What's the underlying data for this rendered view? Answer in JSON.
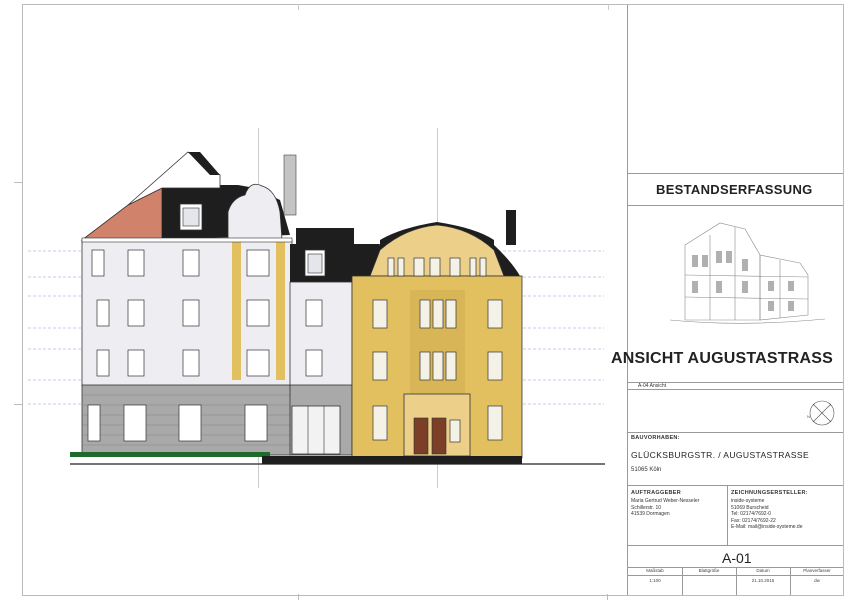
{
  "title_block": {
    "header": "BESTANDSERFASSUNG",
    "view_title": "ANSICHT AUGUSTASTRASS",
    "view_ref": "A-04 Ansicht",
    "project_label": "BAUVORHABEN:",
    "project_name": "GLÜCKSBURGSTR. / AUGUSTASTRASSE",
    "project_city": "51065 Köln",
    "client": {
      "label": "AUFTRAGGEBER",
      "lines": [
        "Maria Gertrud Weber-Nesseler",
        "Schillerstr. 10",
        "41539 Dormagen"
      ]
    },
    "drafter": {
      "label": "ZEICHNUNGSERSTELLER:",
      "lines": [
        "inside-systeme",
        "51069 Burscheid",
        "Tel: 02174/7692-0",
        "Fax: 02174/7692-22",
        "E-Mail: mail@inside-systeme.de"
      ]
    },
    "sheet_number": "A-01",
    "footer": {
      "headers": [
        "Maßstab",
        "Blattgröße",
        "Datum",
        "Planverfasser"
      ],
      "values": [
        "1:100",
        "",
        "21.10.2015",
        "dw"
      ]
    }
  },
  "colors": {
    "plaster_white": "#eeeef2",
    "ochre": "#e2c060",
    "ochre_light": "#ecd08a",
    "stone": "#a9a9a9",
    "roof_black": "#1e1e1e",
    "roof_terracotta": "#d0826a"
  }
}
